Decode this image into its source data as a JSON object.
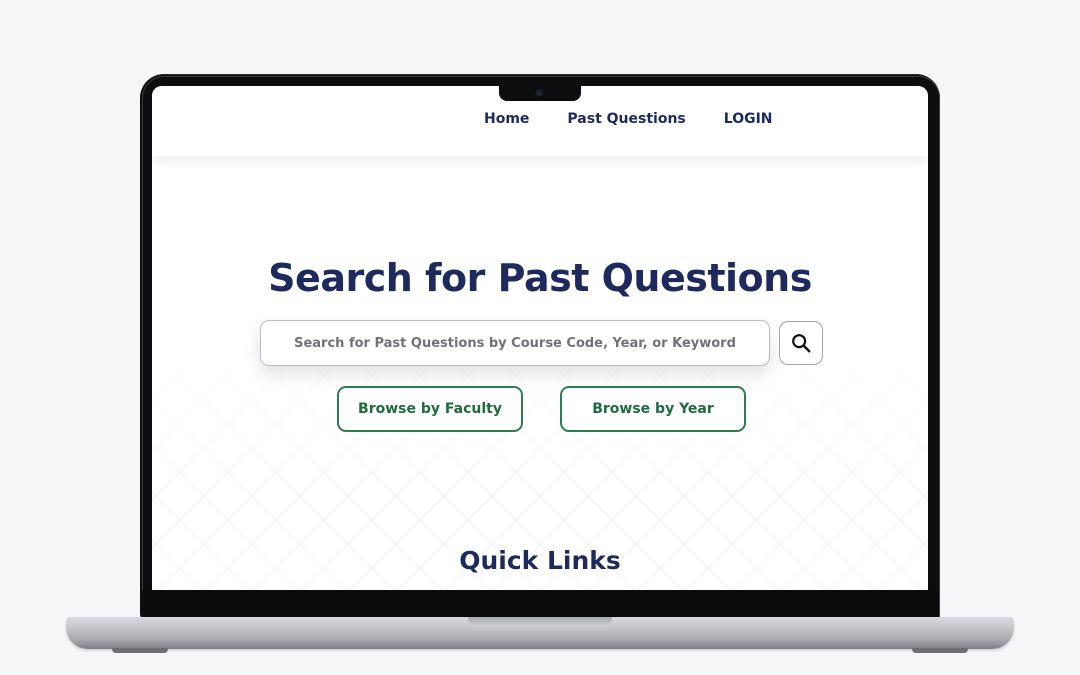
{
  "nav": {
    "items": [
      {
        "label": "Home"
      },
      {
        "label": "Past Questions"
      },
      {
        "label": "LOGIN"
      }
    ]
  },
  "hero": {
    "title": "Search for Past Questions",
    "search": {
      "placeholder": "Search for Past Questions by Course Code, Year, or Keyword",
      "value": "",
      "button_icon": "search-icon"
    },
    "browse_buttons": [
      {
        "label": "Browse by Faculty"
      },
      {
        "label": "Browse by Year"
      }
    ]
  },
  "sections": {
    "quick_links_title": "Quick Links"
  },
  "colors": {
    "page_background": "#f5f6f8",
    "primary_navy": "#1e2a5e",
    "accent_green": "#2e7d4f",
    "laptop_bezel": "#0d0d0f",
    "laptop_base_silver": "#c8c9cd"
  }
}
